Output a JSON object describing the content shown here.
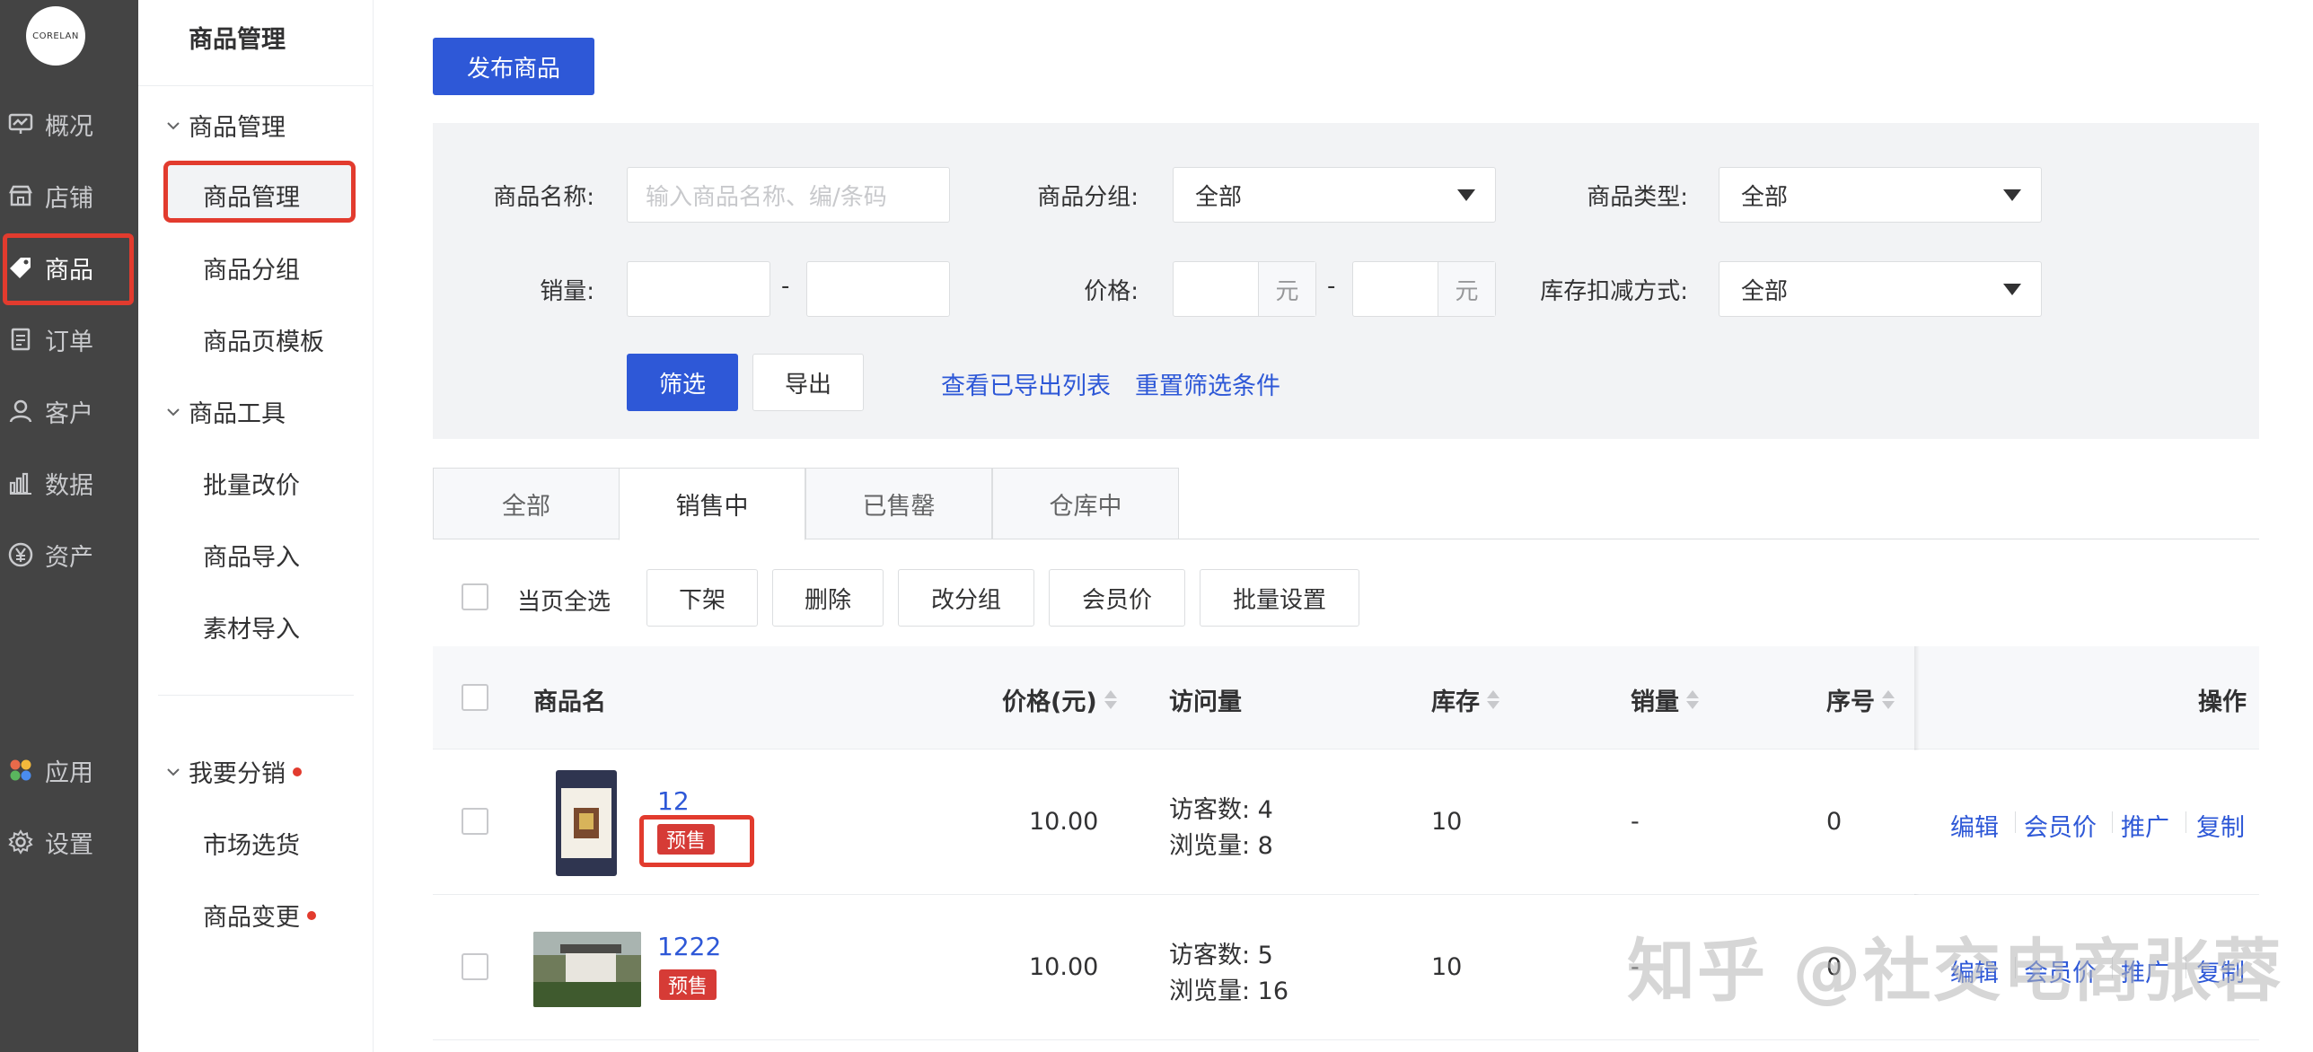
{
  "brand": {
    "logo_text": "CORELAN"
  },
  "nav1": {
    "items": [
      {
        "label": "概况",
        "icon": "dashboard-icon"
      },
      {
        "label": "店铺",
        "icon": "store-icon"
      },
      {
        "label": "商品",
        "icon": "tag-icon"
      },
      {
        "label": "订单",
        "icon": "order-icon"
      },
      {
        "label": "客户",
        "icon": "user-icon"
      },
      {
        "label": "数据",
        "icon": "chart-icon"
      },
      {
        "label": "资产",
        "icon": "yen-icon"
      },
      {
        "label": "应用",
        "icon": "apps-icon"
      },
      {
        "label": "设置",
        "icon": "gear-icon"
      }
    ],
    "active": "商品"
  },
  "nav2": {
    "title": "商品管理",
    "group1": "商品管理",
    "group1_items": [
      "商品管理",
      "商品分组",
      "商品页模板"
    ],
    "group2": "商品工具",
    "group2_items": [
      "批量改价",
      "商品导入",
      "素材导入"
    ],
    "group3": "我要分销",
    "group3_items": [
      "市场选货",
      "商品变更"
    ]
  },
  "main": {
    "publish_button": "发布商品"
  },
  "filters": {
    "name_label": "商品名称:",
    "name_placeholder": "输入商品名称、编/条码",
    "group_label": "商品分组:",
    "group_value": "全部",
    "type_label": "商品类型:",
    "type_value": "全部",
    "sales_label": "销量:",
    "range_sep": "-",
    "price_label": "价格:",
    "price_unit": "元",
    "stock_label": "库存扣减方式:",
    "stock_value": "全部",
    "filter_button": "筛选",
    "export_button": "导出",
    "view_exports_link": "查看已导出列表",
    "reset_link": "重置筛选条件"
  },
  "tabs": [
    "全部",
    "销售中",
    "已售罄",
    "仓库中"
  ],
  "active_tab": "销售中",
  "bulk": {
    "select_all": "当页全选",
    "buttons": [
      "下架",
      "删除",
      "改分组",
      "会员价",
      "批量设置"
    ]
  },
  "table": {
    "headers": {
      "name": "商品名",
      "price": "价格(元)",
      "visits": "访问量",
      "stock": "库存",
      "sales": "销量",
      "order": "序号",
      "ops": "操作"
    },
    "rows": [
      {
        "name": "12",
        "tag": "预售",
        "price": "10.00",
        "visitors": "访客数: 4",
        "views": "浏览量: 8",
        "stock": "10",
        "sales": "-",
        "order": "0"
      },
      {
        "name": "1222",
        "tag": "预售",
        "price": "10.00",
        "visitors": "访客数: 5",
        "views": "浏览量: 16",
        "stock": "10",
        "sales": "-",
        "order": "0"
      }
    ],
    "ops": [
      "编辑",
      "会员价",
      "推广",
      "复制"
    ]
  },
  "watermark": "知乎 @社交电商张蓉"
}
